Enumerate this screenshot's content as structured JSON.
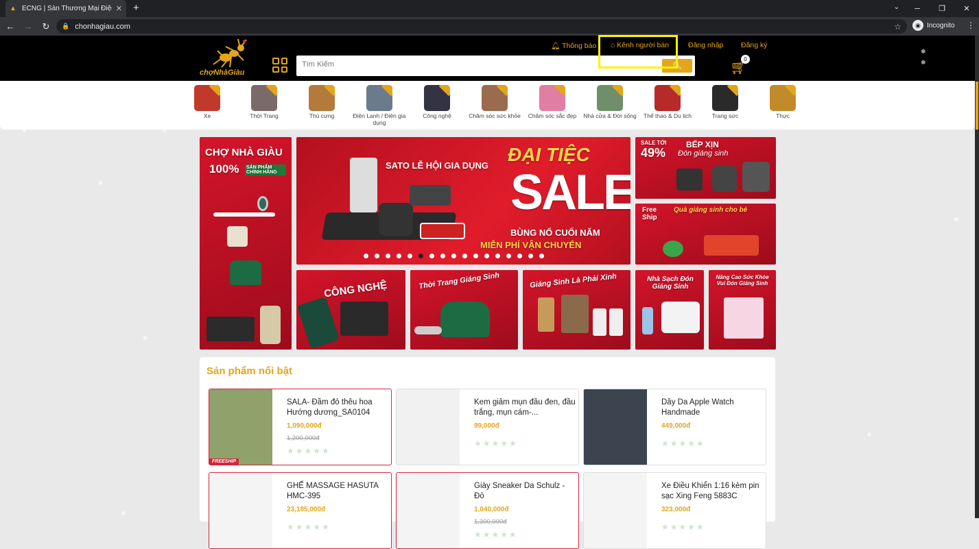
{
  "browser": {
    "tab_title": "ECNG | Sàn Thương Mại Điện Tử",
    "url": "chonhagiau.com",
    "profile_label": "Incognito"
  },
  "header": {
    "brand": "chợNhàGiàu",
    "search_placeholder": "Tìm Kiếm",
    "links": {
      "notifications": "Thông báo",
      "seller_channel": "Kênh người bán",
      "login": "Đăng nhập",
      "register": "Đăng ký"
    },
    "cart_count": "0"
  },
  "categories": [
    {
      "label": "Xe",
      "color": "#c0392b"
    },
    {
      "label": "Thời Trang",
      "color": "#7a6a6a"
    },
    {
      "label": "Thú cưng",
      "color": "#b37a3b"
    },
    {
      "label": "Điện Lanh / Điện gia dụng",
      "color": "#6b7b8c"
    },
    {
      "label": "Công nghệ",
      "color": "#333344"
    },
    {
      "label": "Chăm sóc sức khỏe",
      "color": "#9b6b4f"
    },
    {
      "label": "Chăm sóc sắc đẹp",
      "color": "#e07fa3"
    },
    {
      "label": "Nhà cửa & Đời sống",
      "color": "#6f8f6a"
    },
    {
      "label": "Thể thao & Du lịch",
      "color": "#b72a2a"
    },
    {
      "label": "Trang sức",
      "color": "#2a2a2a"
    },
    {
      "label": "Thực",
      "color": "#c28b2a"
    }
  ],
  "banners": {
    "left": {
      "line1": "CHỢ NHÀ GIÀU",
      "line2": "100%",
      "line3": "SẢN PHẨM CHÍNH HÃNG"
    },
    "main": {
      "brand": "SATO LỄ HỘI GIA DỤNG",
      "big1": "ĐẠI TIỆC",
      "big2": "SALE",
      "sub1": "BÙNG NỔ CUỐI NĂM",
      "sub2": "MIỄN PHÍ VẬN CHUYỂN"
    },
    "top_right1": {
      "badge": "SALE TỚI",
      "pct": "49%",
      "title": "BẾP XỊN",
      "sub": "Đón giáng sinh"
    },
    "top_right2": {
      "title": "Free Ship",
      "sub": "Quà giáng sinh cho bé"
    },
    "bottom": [
      {
        "title": "CÔNG NGHỆ"
      },
      {
        "title": "Thời Trang Giáng Sinh"
      },
      {
        "title": "Giáng Sinh Là Phải Xinh"
      },
      {
        "title": "Nhà Sạch Đón Giáng Sinh"
      },
      {
        "title": "Nâng Cao Sức Khỏe Vui Đón Giáng Sinh"
      }
    ],
    "dots_total": 17,
    "dots_active": 5
  },
  "featured": {
    "title": "Sản phẩm nổi bật",
    "products": [
      {
        "name": "SALA- Đầm đỏ thêu hoa Hướng dương_SA0104",
        "price": "1,090,000đ",
        "old_price": "1,200,000đ",
        "freeship": "FREESHIP",
        "img": "#8fa26b"
      },
      {
        "name": "Kem giảm mụn đầu đen, đầu trắng, mụn cám-...",
        "price": "99,000đ",
        "old_price": "",
        "freeship": "",
        "img": "#f1f1f1"
      },
      {
        "name": "Dây Da Apple Watch Handmade",
        "price": "449,000đ",
        "old_price": "",
        "freeship": "",
        "img": "#3c4450"
      },
      {
        "name": "GHẾ MASSAGE HASUTA HMC-395",
        "price": "23,185,000đ",
        "old_price": "",
        "freeship": "",
        "img": "#f4f4f4"
      },
      {
        "name": "Giày Sneaker Da Schulz - Đỏ",
        "price": "1,040,000đ",
        "old_price": "1,300,000đ",
        "freeship": "",
        "img": "#f4f4f4"
      },
      {
        "name": "Xe Điều Khiển 1:16 kèm pin sạc Xing Feng 5883C",
        "price": "323,000đ",
        "old_price": "",
        "freeship": "",
        "img": "#f4f4f4"
      }
    ],
    "stars": "★★★★★"
  }
}
